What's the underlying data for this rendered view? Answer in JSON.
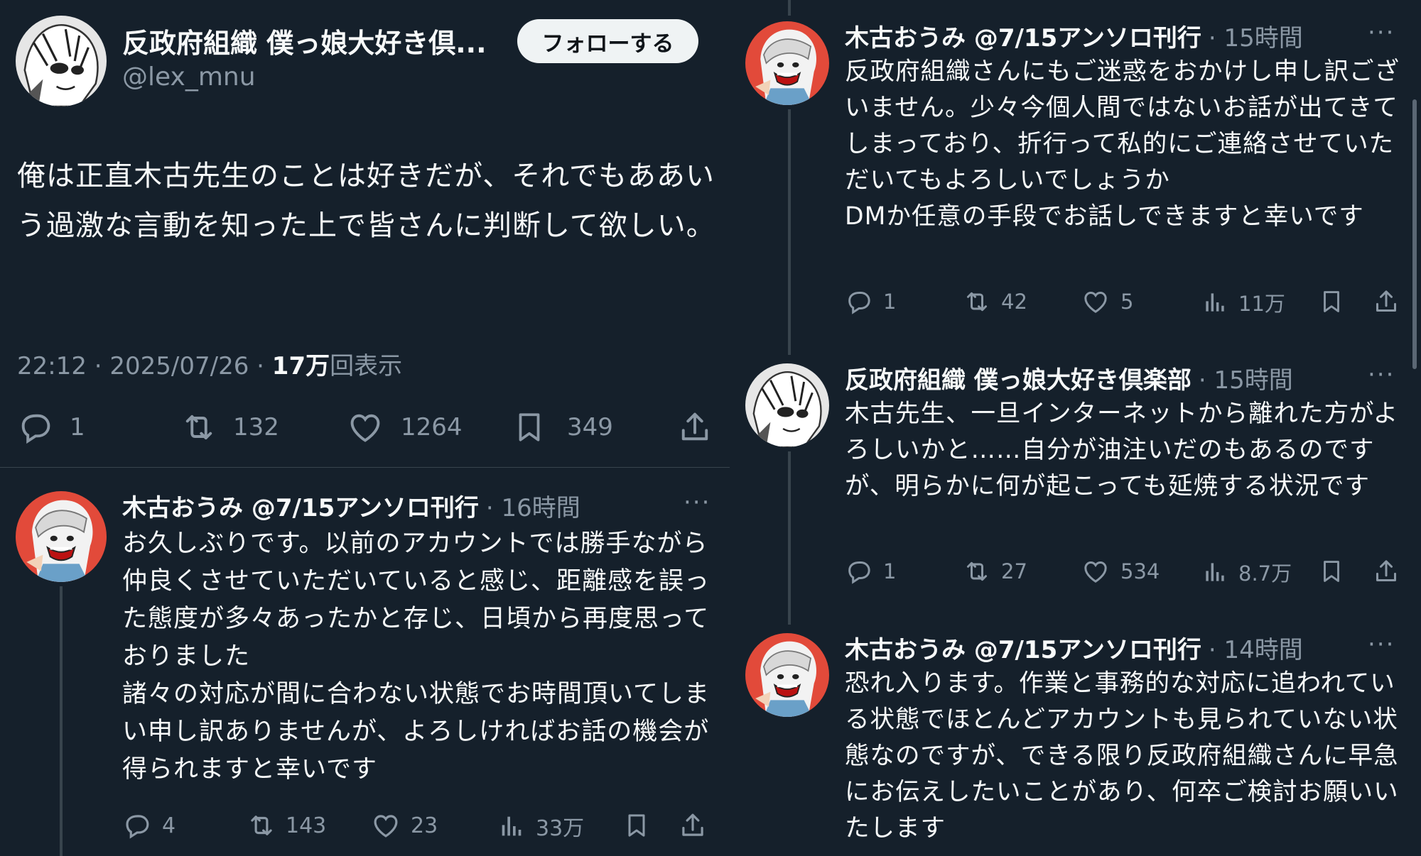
{
  "main_tweet": {
    "author_name": "反政府組織 僕っ娘大好き倶...",
    "handle": "@lex_mnu",
    "follow_label": "フォローする",
    "text": "俺は正直木古先生のことは好きだが、それでもああいう過激な言動を知った上で皆さんに判断して欲しい。",
    "timestamp": "22:12 · 2025/07/26 · ",
    "views_count": "17万",
    "views_label": "回表示",
    "replies": "1",
    "retweets": "132",
    "likes": "1264",
    "bookmarks": "349"
  },
  "left_reply": {
    "author_name": "木古おうみ @7/15アンソロ刊行",
    "time": "· 16時間",
    "more": "···",
    "text": "お久しぶりです。以前のアカウントでは勝手ながら仲良くさせていただいていると感じ、距離感を誤った態度が多々あったかと存じ、日頃から再度思っておりました\n諸々の対応が間に合わない状態でお時間頂いてしまい申し訳ありませんが、よろしければお話の機会が得られますと幸いです",
    "replies": "4",
    "retweets": "143",
    "likes": "23",
    "views": "33万"
  },
  "right_tweets": [
    {
      "author_name": "木古おうみ @7/15アンソロ刊行",
      "time": "· 15時間",
      "more": "···",
      "text": "反政府組織さんにもご迷惑をおかけし申し訳ございません。少々今個人間ではないお話が出てきてしまっており、折行って私的にご連絡させていただいてもよろしいでしょうか\nDMか任意の手段でお話しできますと幸いです",
      "replies": "1",
      "retweets": "42",
      "likes": "5",
      "views": "11万"
    },
    {
      "author_name": "反政府組織 僕っ娘大好き倶楽部",
      "time": "· 15時間",
      "more": "···",
      "text": "木古先生、一旦インターネットから離れた方がよろしいかと……自分が油注いだのもあるのですが、明らかに何が起こっても延焼する状況です",
      "replies": "1",
      "retweets": "27",
      "likes": "534",
      "views": "8.7万"
    },
    {
      "author_name": "木古おうみ @7/15アンソロ刊行",
      "time": "· 14時間",
      "more": "···",
      "text": "恐れ入ります。作業と事務的な対応に追われている状態でほとんどアカウントも見られていない状態なのですが、できる限り反政府組織さんに早急にお伝えしたいことがあり、何卒ご検討お願いいたします"
    }
  ],
  "colors": {
    "background": "#15202b",
    "text": "#f7f9f9",
    "muted": "#8b98a5",
    "divider": "#38444d",
    "follow_bg": "#eff3f4"
  }
}
